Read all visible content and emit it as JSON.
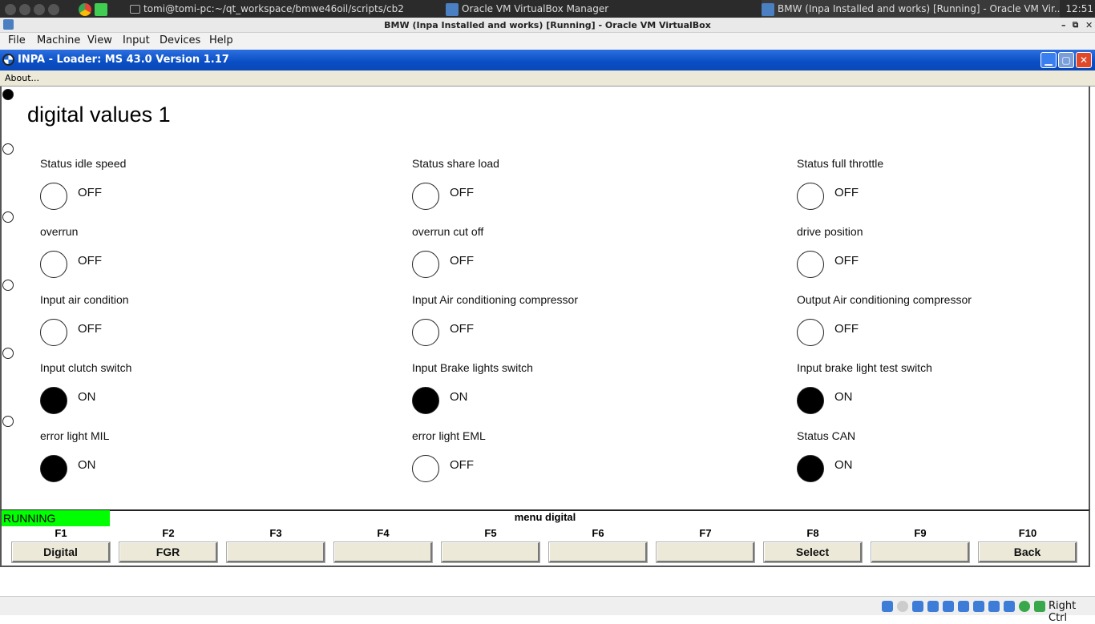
{
  "taskbar": {
    "items": [
      {
        "label": "tomi@tomi-pc:~/qt_workspace/bmwe46oil/scripts/cb2"
      },
      {
        "label": "Oracle VM VirtualBox Manager"
      },
      {
        "label": "BMW (Inpa Installed and works) [Running] - Oracle VM Vir..."
      }
    ],
    "clock": "12:51"
  },
  "vbox": {
    "title": "BMW (Inpa Installed and works) [Running] - Oracle VM VirtualBox",
    "menu": [
      "File",
      "Machine",
      "View",
      "Input",
      "Devices",
      "Help"
    ],
    "status_right": "Right Ctrl"
  },
  "inpa": {
    "title": "INPA - Loader:  MS 43.0 Version 1.17",
    "about": "About..."
  },
  "page": {
    "title": "digital values 1"
  },
  "signals": [
    {
      "label": "Status idle speed",
      "state": "OFF",
      "on": false
    },
    {
      "label": "Status share load",
      "state": "OFF",
      "on": false
    },
    {
      "label": "Status full throttle",
      "state": "OFF",
      "on": false
    },
    {
      "label": "overrun",
      "state": "OFF",
      "on": false
    },
    {
      "label": " overrun cut off",
      "state": "OFF",
      "on": false
    },
    {
      "label": "drive position",
      "state": "OFF",
      "on": false
    },
    {
      "label": "Input air condition",
      "state": "OFF",
      "on": false
    },
    {
      "label": "Input Air conditioning compressor",
      "state": "OFF",
      "on": false
    },
    {
      "label": "Output Air conditioning compressor",
      "state": "OFF",
      "on": false
    },
    {
      "label": "Input clutch switch",
      "state": "ON",
      "on": true
    },
    {
      "label": "Input Brake lights switch",
      "state": "ON",
      "on": true
    },
    {
      "label": "Input brake light test switch",
      "state": "ON",
      "on": true
    },
    {
      "label": "error light MIL",
      "state": "ON",
      "on": true
    },
    {
      "label": " error light EML",
      "state": "OFF",
      "on": false
    },
    {
      "label": "Status CAN",
      "state": "ON",
      "on": true
    }
  ],
  "footer": {
    "status": "RUNNING",
    "menu_title": "menu digital",
    "fkeys": [
      {
        "key": "F1",
        "label": "Digital"
      },
      {
        "key": "F2",
        "label": "FGR"
      },
      {
        "key": "F3",
        "label": ""
      },
      {
        "key": "F4",
        "label": ""
      },
      {
        "key": "F5",
        "label": ""
      },
      {
        "key": "F6",
        "label": ""
      },
      {
        "key": "F7",
        "label": ""
      },
      {
        "key": "F8",
        "label": "Select"
      },
      {
        "key": "F9",
        "label": ""
      },
      {
        "key": "F10",
        "label": "Back"
      }
    ]
  }
}
